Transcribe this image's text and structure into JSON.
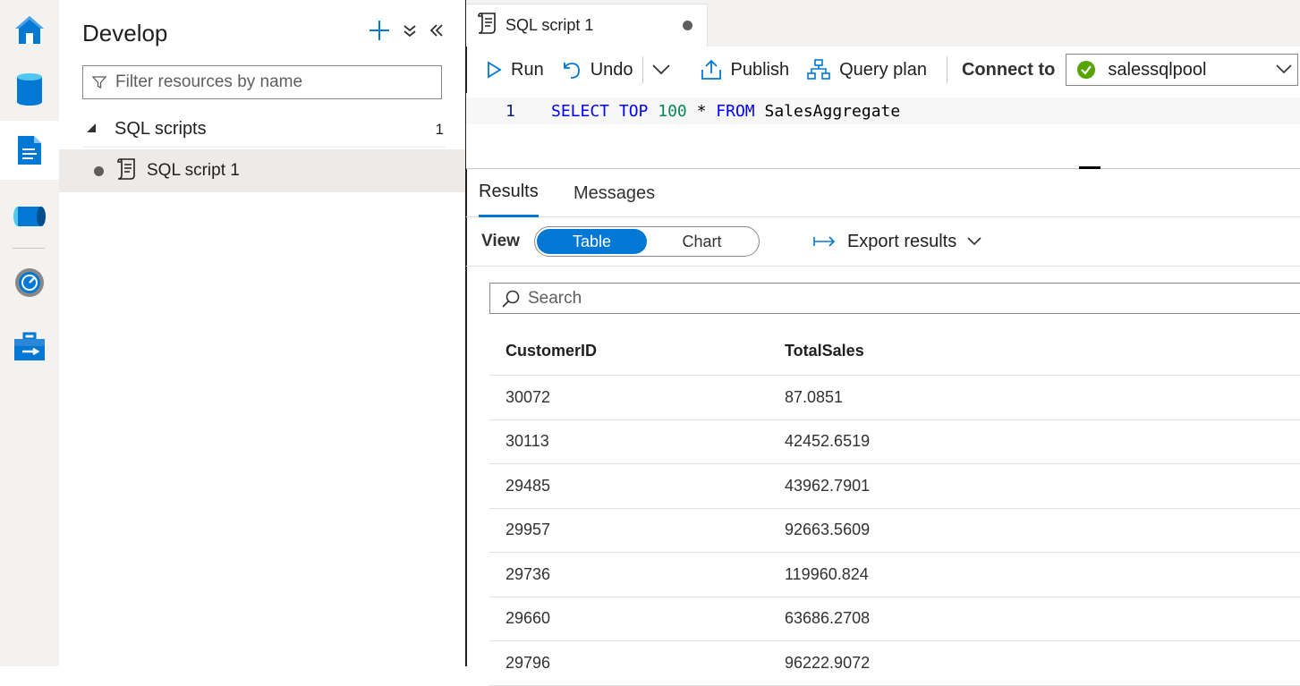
{
  "rail": {
    "items": [
      {
        "icon": "home-icon"
      },
      {
        "icon": "data-icon"
      },
      {
        "icon": "develop-icon"
      },
      {
        "icon": "integrate-icon"
      },
      {
        "icon": "monitor-icon"
      },
      {
        "icon": "manage-icon"
      }
    ]
  },
  "develop": {
    "title": "Develop",
    "filter_placeholder": "Filter resources by name",
    "section_label": "SQL scripts",
    "section_count": "1",
    "items": [
      {
        "label": "SQL script 1"
      }
    ]
  },
  "editor": {
    "tab_label": "SQL script 1",
    "toolbar": {
      "run": "Run",
      "undo": "Undo",
      "publish": "Publish",
      "query_plan": "Query plan",
      "connect_label": "Connect to",
      "connect_value": "salessqlpool"
    },
    "code": {
      "line_number": "1",
      "tokens": [
        "SELECT",
        "TOP",
        "100",
        "*",
        "FROM",
        "SalesAggregate"
      ]
    }
  },
  "results": {
    "tabs": [
      "Results",
      "Messages"
    ],
    "view_label": "View",
    "view_options": [
      "Table",
      "Chart"
    ],
    "view_selected": "Table",
    "export_label": "Export results",
    "search_placeholder": "Search",
    "columns": [
      "CustomerID",
      "TotalSales"
    ],
    "rows": [
      [
        "30072",
        "87.0851"
      ],
      [
        "30113",
        "42452.6519"
      ],
      [
        "29485",
        "43962.7901"
      ],
      [
        "29957",
        "92663.5609"
      ],
      [
        "29736",
        "119960.824"
      ],
      [
        "29660",
        "63686.2708"
      ],
      [
        "29796",
        "96222.9072"
      ]
    ]
  },
  "colors": {
    "accent": "#0078d4",
    "success": "#57a300",
    "keyword": "#0000ff",
    "number": "#098658"
  }
}
